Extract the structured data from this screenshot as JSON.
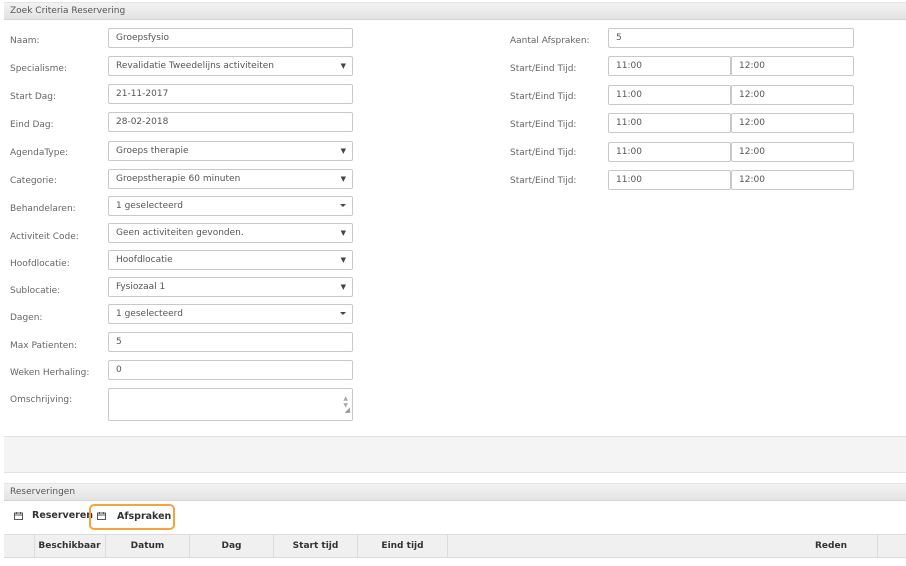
{
  "criteria_panel": {
    "title": "Zoek Criteria Reservering"
  },
  "form": {
    "naam": {
      "label": "Naam:",
      "value": "Groepsfysio"
    },
    "specialisme": {
      "label": "Specialisme:",
      "value": "Revalidatie Tweedelijns activiteiten"
    },
    "start_dag": {
      "label": "Start Dag:",
      "value": "21-11-2017"
    },
    "eind_dag": {
      "label": "Eind Dag:",
      "value": "28-02-2018"
    },
    "agenda_type": {
      "label": "AgendaType:",
      "value": "Groeps therapie"
    },
    "categorie": {
      "label": "Categorie:",
      "value": "Groepstherapie 60 minuten"
    },
    "behandelaren": {
      "label": "Behandelaren:",
      "value": "1 geselecteerd"
    },
    "activiteit_code": {
      "label": "Activiteit Code:",
      "value": "Geen activiteiten gevonden."
    },
    "hoofdlocatie": {
      "label": "Hoofdlocatie:",
      "value": "Hoofdlocatie"
    },
    "sublocatie": {
      "label": "Sublocatie:",
      "value": "Fysiozaal 1"
    },
    "dagen": {
      "label": "Dagen:",
      "value": "1 geselecteerd"
    },
    "max_patienten": {
      "label": "Max Patienten:",
      "value": "5"
    },
    "weken_herhaling": {
      "label": "Weken Herhaling:",
      "value": "0"
    },
    "omschrijving": {
      "label": "Omschrijving:",
      "value": ""
    }
  },
  "right_form": {
    "aantal_afspraken": {
      "label": "Aantal Afspraken:",
      "value": "5"
    },
    "times": [
      {
        "label": "Start/Eind Tijd:",
        "start": "11:00",
        "end": "12:00"
      },
      {
        "label": "Start/Eind Tijd:",
        "start": "11:00",
        "end": "12:00"
      },
      {
        "label": "Start/Eind Tijd:",
        "start": "11:00",
        "end": "12:00"
      },
      {
        "label": "Start/Eind Tijd:",
        "start": "11:00",
        "end": "12:00"
      },
      {
        "label": "Start/Eind Tijd:",
        "start": "11:00",
        "end": "12:00"
      }
    ]
  },
  "reserveringen_panel": {
    "title": "Reserveringen"
  },
  "toolbar": {
    "reserveren_label": "Reserveren",
    "afspraken_label": "Afspraken",
    "icon": "calendar-icon",
    "active_border_color": "#f5a33b"
  },
  "table": {
    "columns": [
      "Beschikbaar",
      "Datum",
      "Dag",
      "Start tijd",
      "Eind tijd",
      "Reden"
    ]
  }
}
